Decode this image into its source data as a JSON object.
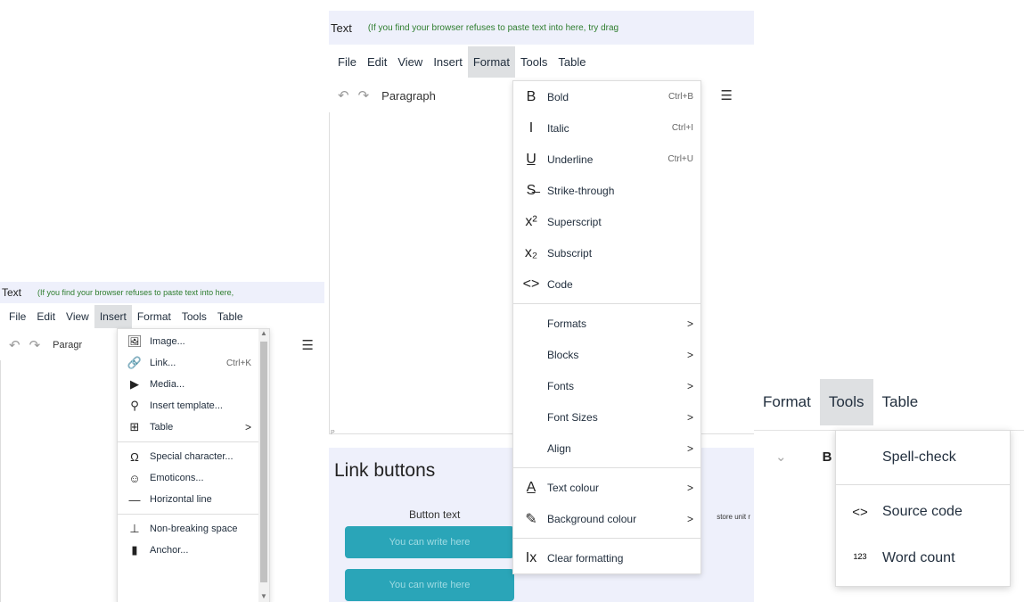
{
  "panel1": {
    "title": "Text",
    "hint": "(If you find your browser refuses to paste text into here,",
    "menubar": [
      "File",
      "Edit",
      "View",
      "Insert",
      "Format",
      "Tools",
      "Table"
    ],
    "active_menu": "Insert",
    "toolbar_text": "Paragr",
    "insert_menu": [
      {
        "icon": "image-icon",
        "glyph": "🖼",
        "label": "Image...",
        "shortcut": ""
      },
      {
        "icon": "link-icon",
        "glyph": "🔗",
        "label": "Link...",
        "shortcut": "Ctrl+K"
      },
      {
        "icon": "media-icon",
        "glyph": "▶",
        "label": "Media...",
        "shortcut": ""
      },
      {
        "icon": "template-icon",
        "glyph": "⚲",
        "label": "Insert template...",
        "shortcut": ""
      },
      {
        "icon": "table-icon",
        "glyph": "⊞",
        "label": "Table",
        "shortcut": "",
        "submenu": ">"
      },
      {
        "sep": true
      },
      {
        "icon": "omega-icon",
        "glyph": "Ω",
        "label": "Special character...",
        "shortcut": ""
      },
      {
        "icon": "emoticon-icon",
        "glyph": "☺",
        "label": "Emoticons...",
        "shortcut": ""
      },
      {
        "icon": "hr-icon",
        "glyph": "—",
        "label": "Horizontal line",
        "shortcut": ""
      },
      {
        "sep": true
      },
      {
        "icon": "nbsp-icon",
        "glyph": "⊥",
        "label": "Non-breaking space",
        "shortcut": ""
      },
      {
        "icon": "anchor-icon",
        "glyph": "▮",
        "label": "Anchor...",
        "shortcut": ""
      }
    ]
  },
  "panel2": {
    "title": "Text",
    "hint": "(If you find your browser refuses to paste text into here, try drag",
    "menubar": [
      "File",
      "Edit",
      "View",
      "Insert",
      "Format",
      "Tools",
      "Table"
    ],
    "active_menu": "Format",
    "toolbar_text": "Paragraph",
    "path_text": "P",
    "format_menu": [
      {
        "icon": "bold-icon",
        "glyph": "B",
        "label": "Bold",
        "shortcut": "Ctrl+B"
      },
      {
        "icon": "italic-icon",
        "glyph": "I",
        "label": "Italic",
        "shortcut": "Ctrl+I"
      },
      {
        "icon": "underline-icon",
        "glyph": "U̲",
        "label": "Underline",
        "shortcut": "Ctrl+U"
      },
      {
        "icon": "strikethrough-icon",
        "glyph": "S̶",
        "label": "Strike-through",
        "shortcut": ""
      },
      {
        "icon": "superscript-icon",
        "glyph": "x²",
        "label": "Superscript",
        "shortcut": ""
      },
      {
        "icon": "subscript-icon",
        "glyph": "x₂",
        "label": "Subscript",
        "shortcut": ""
      },
      {
        "icon": "code-icon",
        "glyph": "<>",
        "label": "Code",
        "shortcut": ""
      },
      {
        "sep": true
      },
      {
        "icon": "",
        "glyph": "",
        "label": "Formats",
        "shortcut": "",
        "submenu": ">"
      },
      {
        "icon": "",
        "glyph": "",
        "label": "Blocks",
        "shortcut": "",
        "submenu": ">"
      },
      {
        "icon": "",
        "glyph": "",
        "label": "Fonts",
        "shortcut": "",
        "submenu": ">"
      },
      {
        "icon": "",
        "glyph": "",
        "label": "Font Sizes",
        "shortcut": "",
        "submenu": ">"
      },
      {
        "icon": "",
        "glyph": "",
        "label": "Align",
        "shortcut": "",
        "submenu": ">"
      },
      {
        "sep": true
      },
      {
        "icon": "text-colour-icon",
        "glyph": "A̲",
        "label": "Text colour",
        "shortcut": "",
        "submenu": ">"
      },
      {
        "icon": "background-colour-icon",
        "glyph": "✎",
        "label": "Background colour",
        "shortcut": "",
        "submenu": ">"
      },
      {
        "sep": true
      },
      {
        "icon": "clear-formatting-icon",
        "glyph": "Ix",
        "label": "Clear formatting",
        "shortcut": ""
      }
    ],
    "link_buttons": {
      "heading": "Link buttons",
      "button_text_label": "Button text",
      "side_text": "store unit r",
      "buttons": [
        "You can write here",
        "You can write here"
      ]
    }
  },
  "panel3": {
    "menubar": [
      "Format",
      "Tools",
      "Table"
    ],
    "active_menu": "Tools",
    "tools_menu": [
      {
        "icon": "",
        "glyph": "",
        "label": "Spell-check"
      },
      {
        "sep": true
      },
      {
        "icon": "source-code-icon",
        "glyph": "<>",
        "label": "Source code"
      },
      {
        "icon": "word-count-icon",
        "glyph": "¹²³",
        "label": "Word count"
      }
    ]
  }
}
